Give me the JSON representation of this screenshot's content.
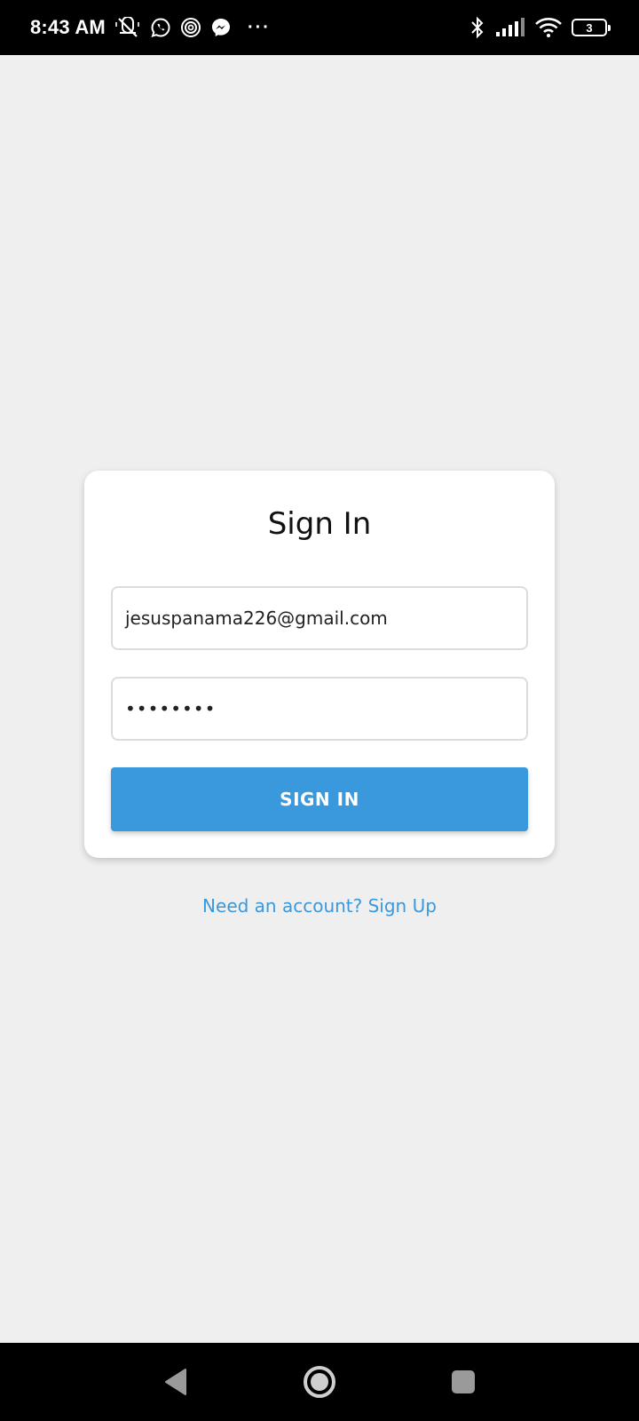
{
  "status_bar": {
    "time": "8:43 AM",
    "battery_level": "3",
    "left_icons": [
      "muted-mic-icon",
      "whatsapp-icon",
      "threads-icon",
      "messenger-icon",
      "more-dots-icon"
    ],
    "right_icons": [
      "bluetooth-icon",
      "cell-signal-icon",
      "wifi-icon",
      "battery-icon"
    ],
    "dots": "···"
  },
  "signin_card": {
    "title": "Sign In",
    "email_value": "jesuspanama226@gmail.com",
    "password_value": "••••••••",
    "submit_label": "SIGN IN"
  },
  "signup_link": "Need an account? Sign Up",
  "nav_bar": {
    "buttons": [
      "back-icon",
      "home-icon",
      "recents-icon"
    ]
  },
  "colors": {
    "accent": "#3a98dc",
    "background": "#efefef",
    "card": "#ffffff",
    "system_bars": "#000000"
  }
}
